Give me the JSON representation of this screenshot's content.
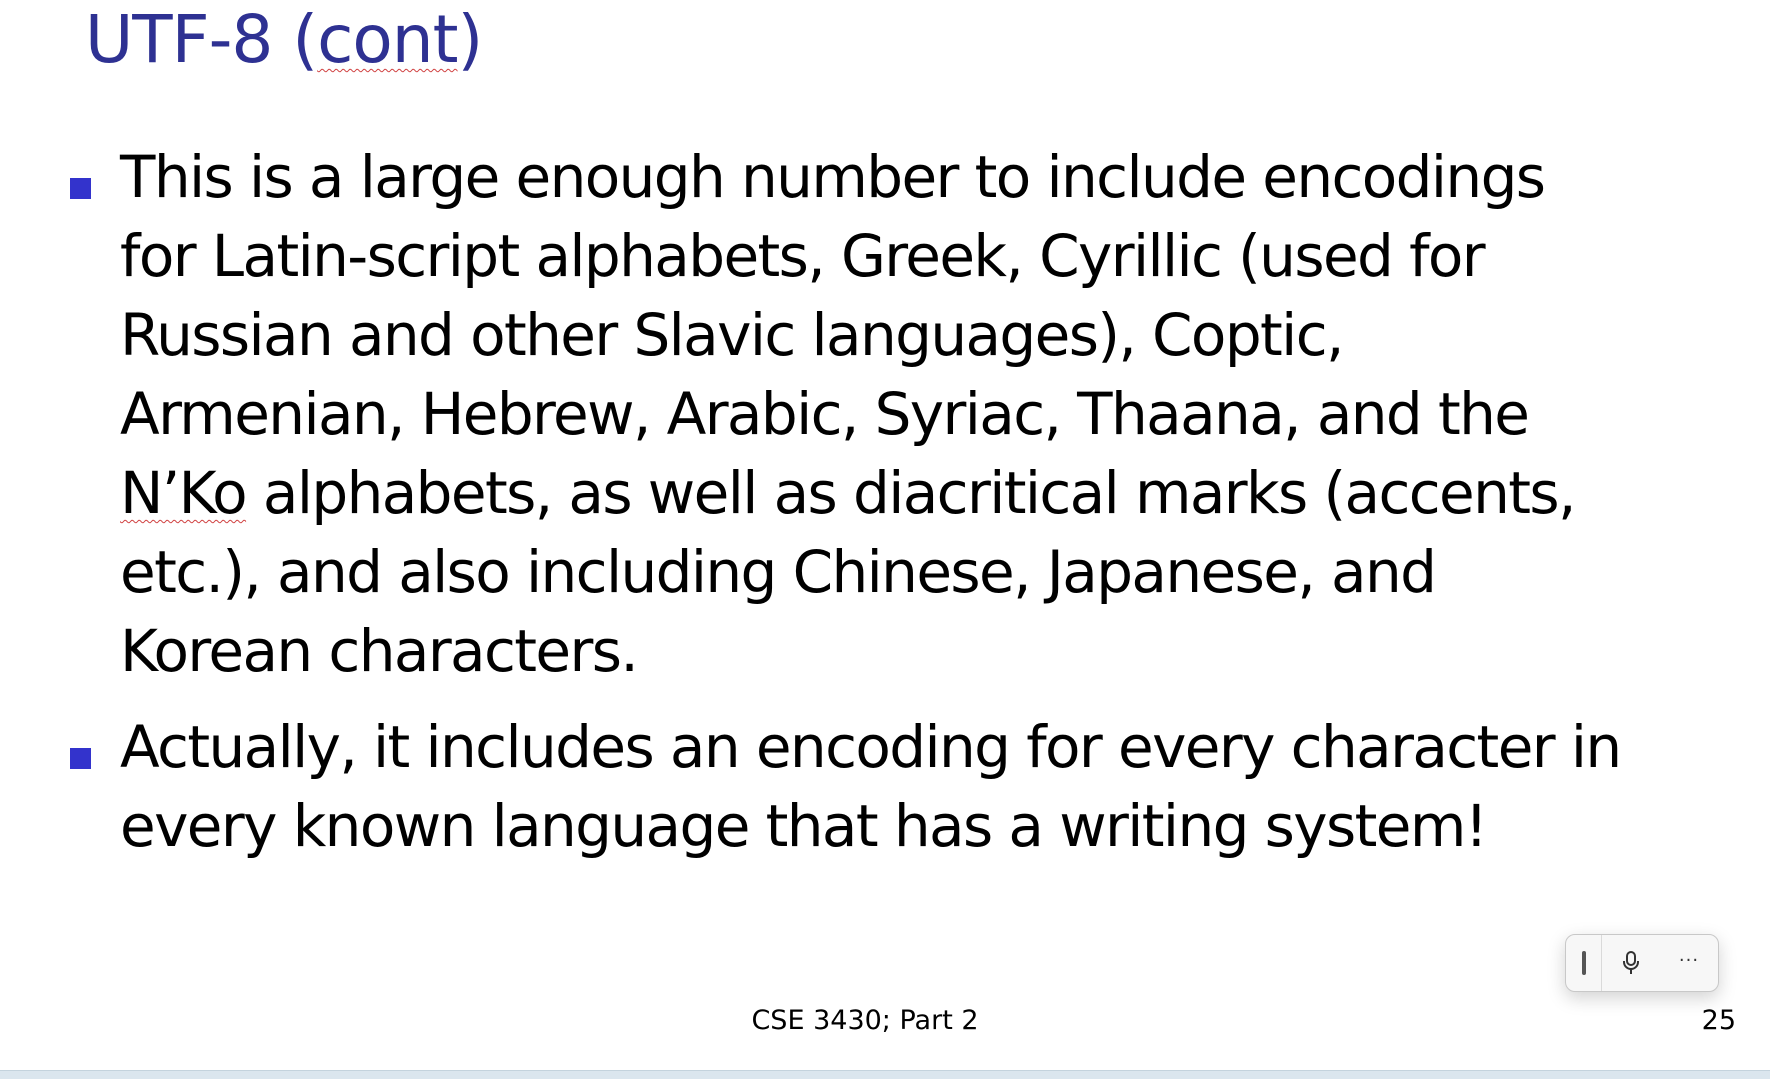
{
  "slide": {
    "title": "UTF-8 (cont)",
    "bullets": [
      "This is a large enough number to include encodings\nfor Latin-script alphabets, Greek, Cyrillic (used for\nRussian and other Slavic languages), Coptic,\nArmenian, Hebrew, Arabic, Syriac, Thaana, and the\nN’Ko alphabets, as well as diacritical marks (accents,\netc.), and also including Chinese, Japanese, and\nKorean characters.",
      "Actually, it includes an encoding for every character in\nevery known language that has a writing system!"
    ],
    "footer": "CSE 3430; Part 2",
    "page_number": "25"
  },
  "colors": {
    "title": "#2e3192",
    "bullet": "#3333cc",
    "text": "#000000"
  },
  "voice_toolbar": {
    "icons": [
      "grip-icon",
      "microphone-icon",
      "more-options-icon"
    ],
    "more_label": "···"
  }
}
